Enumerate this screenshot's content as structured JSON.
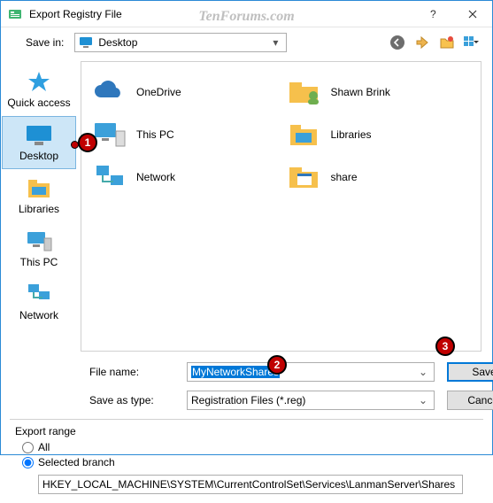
{
  "window": {
    "title": "Export Registry File"
  },
  "watermark": "TenForums.com",
  "toolbar": {
    "savein_label": "Save in:",
    "savein_value": "Desktop"
  },
  "places": [
    {
      "key": "quickaccess",
      "label": "Quick access"
    },
    {
      "key": "desktop",
      "label": "Desktop"
    },
    {
      "key": "libraries",
      "label": "Libraries"
    },
    {
      "key": "thispc",
      "label": "This PC"
    },
    {
      "key": "network",
      "label": "Network"
    }
  ],
  "files": [
    {
      "key": "onedrive",
      "label": "OneDrive"
    },
    {
      "key": "shawn",
      "label": "Shawn Brink"
    },
    {
      "key": "thispc",
      "label": "This PC"
    },
    {
      "key": "libraries",
      "label": "Libraries"
    },
    {
      "key": "network",
      "label": "Network"
    },
    {
      "key": "share",
      "label": "share"
    }
  ],
  "bottom": {
    "filename_label": "File name:",
    "filename_value": "MyNetworkShares",
    "saveas_label": "Save as type:",
    "saveas_value": "Registration Files (*.reg)",
    "save_btn": "Save",
    "cancel_btn": "Cancel"
  },
  "export": {
    "legend": "Export range",
    "all_label": "All",
    "selected_label": "Selected branch",
    "branch_value": "HKEY_LOCAL_MACHINE\\SYSTEM\\CurrentControlSet\\Services\\LanmanServer\\Shares"
  },
  "annotations": {
    "1": "1",
    "2": "2",
    "3": "3"
  }
}
